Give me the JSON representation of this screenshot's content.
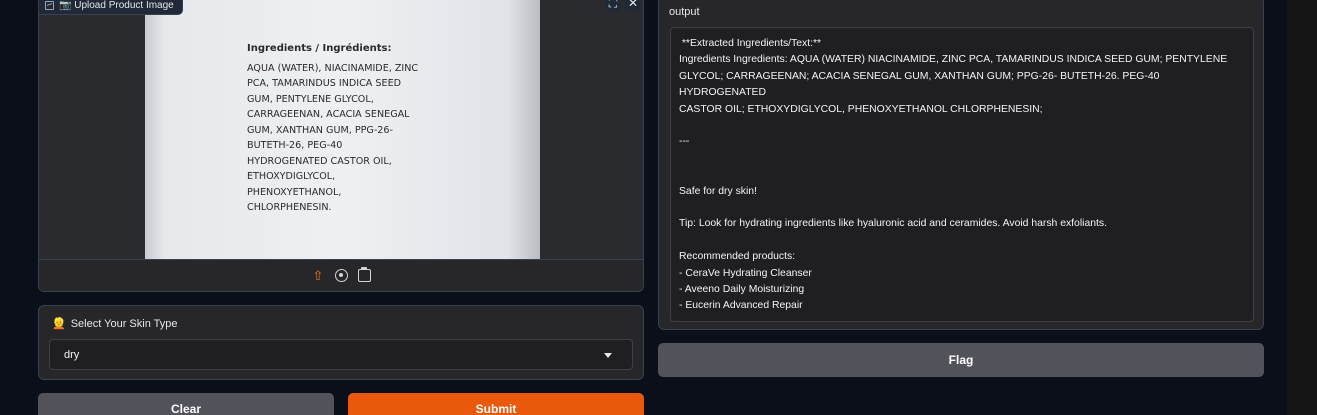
{
  "image_input": {
    "label": "📷 Upload Product Image",
    "product_label": {
      "title": "Ingredients / Ingrédients:",
      "lines": [
        "AQUA (WATER), NIACINAMIDE, ZINC",
        "PCA, TAMARINDUS INDICA SEED",
        "GUM, PENTYLENE GLYCOL,",
        "CARRAGEENAN, ACACIA SENEGAL",
        "GUM, XANTHAN GUM, PPG-26-",
        "BUTETH-26, PEG-40",
        "HYDROGENATED CASTOR OIL,",
        "ETHOXYDIGLYCOL,",
        "PHENOXYETHANOL,",
        "CHLORPHENESIN."
      ]
    },
    "top_icons": {
      "fullscreen": "⛶",
      "close": "✕"
    },
    "toolbar_icons": [
      "upload-icon",
      "webcam-icon",
      "clipboard-icon"
    ],
    "upload_glyph": "⇧"
  },
  "skin_type": {
    "label": "Select Your Skin Type",
    "emoji": "👱",
    "selected": "dry"
  },
  "buttons": {
    "clear": "Clear",
    "submit": "Submit",
    "flag": "Flag"
  },
  "output": {
    "label": "output",
    "lines": [
      " **Extracted Ingredients/Text:**",
      "Ingredients Ingredients: AQUA (WATER) NIACINAMIDE, ZINC PCA, TAMARINDUS INDICA SEED GUM; PENTYLENE",
      "GLYCOL; CARRAGEENAN; ACACIA SENEGAL GUM, XANTHAN GUM; PPG-26- BUTETH-26. PEG-40 HYDROGENATED",
      "CASTOR OIL; ETHOXYDIGLYCOL, PHENOXYETHANOL CHLORPHENESIN;",
      "",
      "---",
      "",
      "",
      "Safe for dry skin!",
      "",
      "Tip: Look for hydrating ingredients like hyaluronic acid and ceramides. Avoid harsh exfoliants.",
      "",
      "Recommended products:",
      "- CeraVe Hydrating Cleanser",
      "- Aveeno Daily Moisturizing",
      "- Eucerin Advanced Repair"
    ]
  },
  "colors": {
    "background": "#0b0f19",
    "panel": "#27272a",
    "accent": "#ea580c",
    "secondary_button": "#52525b"
  }
}
